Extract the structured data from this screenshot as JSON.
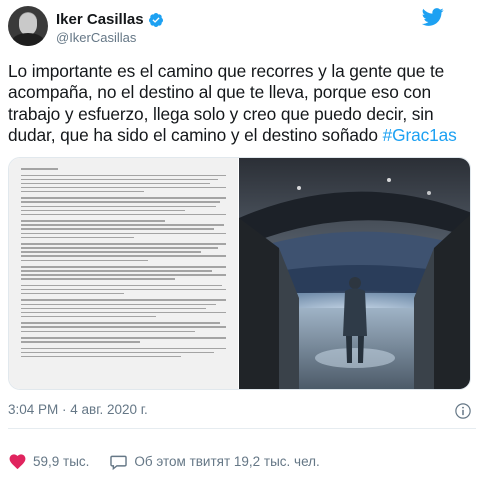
{
  "author": {
    "name": "Iker Casillas",
    "handle": "@IkerCasillas",
    "verified_icon": "verified-badge-icon",
    "platform_icon": "twitter-bird-icon"
  },
  "tweet": {
    "text": "Lo importante es el camino que recorres y la gente que te acompaña, no el destino al que te lleva, porque eso con trabajo y esfuerzo, llega solo y creo que puedo decir, sin dudar, que ha sido el camino y el destino soñado ",
    "hashtag": "#Grac1as"
  },
  "meta": {
    "time": "3:04 PM",
    "separator": " · ",
    "date": "4 авг. 2020 г."
  },
  "actions": {
    "likes": "59,9 тыс.",
    "discussion": "Об этом твитят 19,2 тыс. чел."
  },
  "colors": {
    "accent": "#1da1f2",
    "like": "#e0245e",
    "muted": "#657786",
    "text": "#14171a"
  }
}
